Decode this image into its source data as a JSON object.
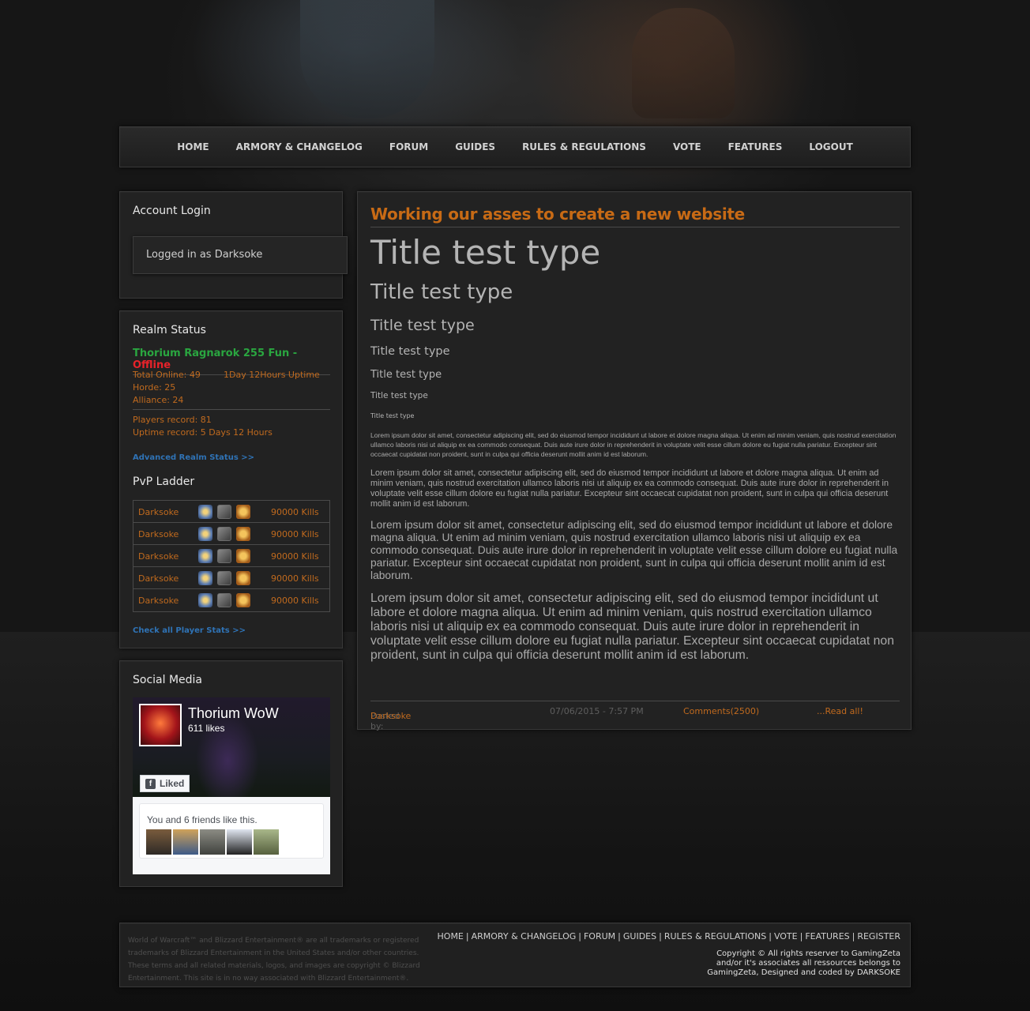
{
  "nav": {
    "items": [
      "HOME",
      "ARMORY & CHANGELOG",
      "FORUM",
      "GUIDES",
      "RULES & REGULATIONS",
      "VOTE",
      "FEATURES",
      "LOGOUT"
    ]
  },
  "account": {
    "title": "Account Login",
    "status": "Logged in as Darksoke"
  },
  "realm": {
    "title": "Realm Status",
    "name": "Thorium Ragnarok 255 Fun - ",
    "state": "Offline",
    "total_online": "Total Online: 49",
    "uptime": "1Day 12Hours Uptime",
    "horde": "Horde: 25",
    "alliance": "Alliance: 24",
    "players_record": "Players record: 81",
    "uptime_record": "Uptime record: 5 Days 12 Hours",
    "advanced_link": "Advanced Realm Status >>"
  },
  "pvp": {
    "title": "PvP Ladder",
    "rows": [
      {
        "name": "Darksoke",
        "kills": "90000 Kills"
      },
      {
        "name": "Darksoke",
        "kills": "90000 Kills"
      },
      {
        "name": "Darksoke",
        "kills": "90000 Kills"
      },
      {
        "name": "Darksoke",
        "kills": "90000 Kills"
      },
      {
        "name": "Darksoke",
        "kills": "90000 Kills"
      }
    ],
    "all_stats_link": "Check all Player Stats >>"
  },
  "social": {
    "title": "Social Media",
    "page_name": "Thorium WoW",
    "likes": "611 likes",
    "liked_button": "Liked",
    "fb_glyph": "f",
    "friends_text": "You and 6 friends like this."
  },
  "news": {
    "title": "Working our asses to create a new website",
    "headings": [
      "Title test type",
      "Title test type",
      "Title test type",
      "Title test type",
      "Title test type",
      "Title test type",
      "Title test type"
    ],
    "paragraphs": [
      "Lorem ipsum dolor sit amet, consectetur adipiscing elit, sed do eiusmod tempor incididunt ut labore et dolore magna aliqua. Ut enim ad minim veniam, quis nostrud exercitation ullamco laboris nisi ut aliquip ex ea commodo consequat. Duis aute irure dolor in reprehenderit in voluptate velit esse cillum dolore eu fugiat nulla pariatur. Excepteur sint occaecat cupidatat non proident, sunt in culpa qui officia deserunt mollit anim id est laborum.",
      "Lorem ipsum dolor sit amet, consectetur adipiscing elit, sed do eiusmod tempor incididunt ut labore et dolore magna aliqua. Ut enim ad minim veniam, quis nostrud exercitation ullamco laboris nisi ut aliquip ex ea commodo consequat. Duis aute irure dolor in reprehenderit in voluptate velit esse cillum dolore eu fugiat nulla pariatur. Excepteur sint occaecat cupidatat non proident, sunt in culpa qui officia deserunt mollit anim id est laborum.",
      "Lorem ipsum dolor sit amet, consectetur adipiscing elit, sed do eiusmod tempor incididunt ut labore et dolore magna aliqua. Ut enim ad minim veniam, quis nostrud exercitation ullamco laboris nisi ut aliquip ex ea commodo consequat. Duis aute irure dolor in reprehenderit in voluptate velit esse cillum dolore eu fugiat nulla pariatur. Excepteur sint occaecat cupidatat non proident, sunt in culpa qui officia deserunt mollit anim id est laborum.",
      "Lorem ipsum dolor sit amet, consectetur adipiscing elit, sed do eiusmod tempor incididunt ut labore et dolore magna aliqua. Ut enim ad minim veniam, quis nostrud exercitation ullamco laboris nisi ut aliquip ex ea commodo consequat. Duis aute irure dolor in reprehenderit in voluptate velit esse cillum dolore eu fugiat nulla pariatur. Excepteur sint occaecat cupidatat non proident, sunt in culpa qui officia deserunt mollit anim id est laborum."
    ],
    "posted_by_label": "Posted by: ",
    "author": "Darksoke",
    "date": "07/06/2015 - 7:57 PM",
    "comments": "Comments(2500)",
    "read_all": "...Read all!"
  },
  "footer": {
    "legal": "World of Warcraft™ and Blizzard Entertainment® are all trademarks or registered trademarks of Blizzard Entertainment in the United States and/or other countries. These terms and all related materials, logos, and images are copyright © Blizzard Entertainment. This site is in no way associated with Blizzard Entertainment®.",
    "nav": [
      "HOME",
      "ARMORY & CHANGELOG",
      "FORUM",
      "GUIDES",
      "RULES & REGULATIONS",
      "VOTE",
      "FEATURES",
      "REGISTER"
    ],
    "separator": "|",
    "copyright": "Copyright © All rights reserver to GamingZeta and/or it's associates all ressources belongs to GamingZeta, Designed and coded by DARKSOKE"
  },
  "colors": {
    "accent_orange": "#c76a15",
    "online_green": "#2aa640",
    "offline_red": "#e8222a",
    "link_blue": "#2f73b6"
  }
}
